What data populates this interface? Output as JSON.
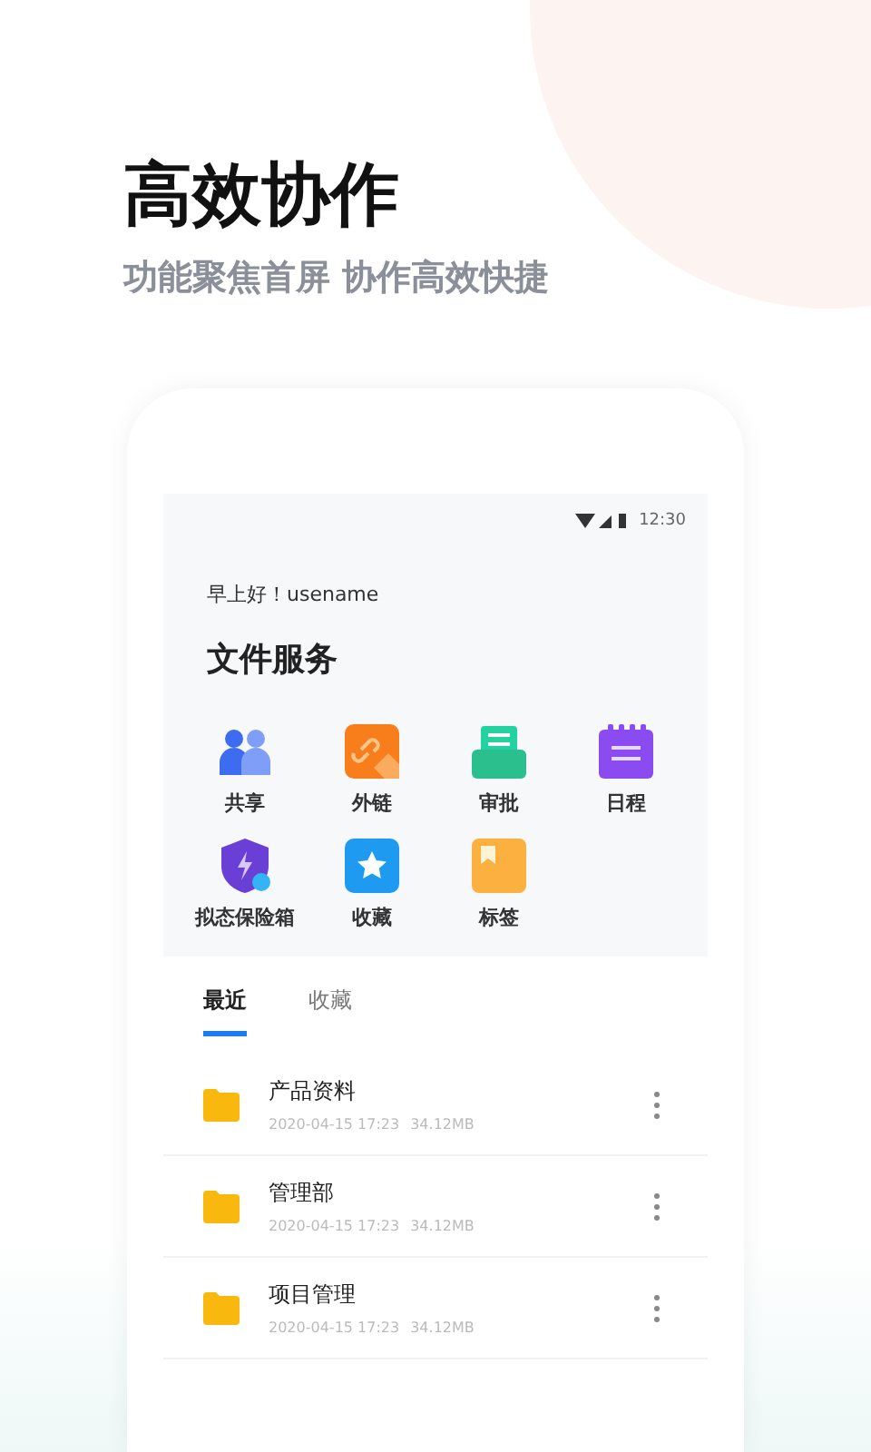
{
  "headline": "高效协作",
  "subtitle": "功能聚焦首屏  协作高效快捷",
  "phone": {
    "status_bar": {
      "time": "12:30"
    },
    "greeting": "早上好！usename",
    "section_title": "文件服务",
    "functions": [
      {
        "kind": "people",
        "label": "共享"
      },
      {
        "kind": "link",
        "label": "外链"
      },
      {
        "kind": "tray",
        "label": "审批"
      },
      {
        "kind": "calendar",
        "label": "日程"
      },
      {
        "kind": "shield",
        "label": "拟态保险箱"
      },
      {
        "kind": "star",
        "label": "收藏"
      },
      {
        "kind": "note",
        "label": "标签"
      }
    ],
    "tabs": [
      {
        "label": "最近",
        "selected": true
      },
      {
        "label": "收藏",
        "selected": false
      }
    ],
    "files": [
      {
        "name": "产品资料",
        "date": "2020-04-15 17:23",
        "size": "34.12MB"
      },
      {
        "name": "管理部",
        "date": "2020-04-15 17:23",
        "size": "34.12MB"
      },
      {
        "name": "项目管理",
        "date": "2020-04-15 17:23",
        "size": "34.12MB"
      }
    ]
  }
}
